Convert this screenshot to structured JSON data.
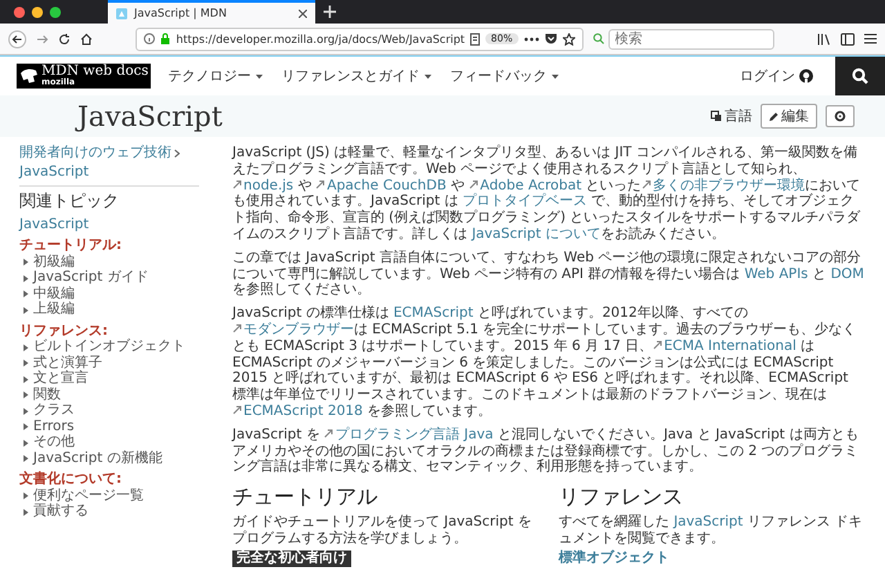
{
  "browser": {
    "tabs": [
      {
        "title": "JavaScript | MDN",
        "selected": true
      }
    ],
    "url": "https://developer.mozilla.org/ja/docs/Web/JavaScript",
    "zoom": "80%",
    "search": {
      "placeholder": "検索"
    }
  },
  "header": {
    "logo": {
      "title": "MDN web docs",
      "sub": "mozilla"
    },
    "menus": [
      {
        "label": "テクノロジー"
      },
      {
        "label": "リファレンスとガイド"
      },
      {
        "label": "フィードバック"
      }
    ],
    "login": "ログイン"
  },
  "title_band": {
    "title": "JavaScript",
    "language": "言語",
    "edit": "編集"
  },
  "sidebar": {
    "breadcrumbs": [
      "開発者向けのウェブ技術",
      "JavaScript"
    ],
    "heading": "関連トピック",
    "top_link": "JavaScript",
    "groups": [
      {
        "title": "チュートリアル:",
        "items": [
          {
            "label": "初級編",
            "expanded": false
          },
          {
            "label": "JavaScript ガイド",
            "expanded": false
          },
          {
            "label": "中級編",
            "expanded": false
          },
          {
            "label": "上級編",
            "expanded": false
          }
        ]
      },
      {
        "title": "リファレンス:",
        "items": [
          {
            "label": "ビルトインオブジェクト",
            "expanded": false
          },
          {
            "label": "式と演算子",
            "expanded": false
          },
          {
            "label": "文と宣言",
            "expanded": false
          },
          {
            "label": "関数",
            "expanded": false
          },
          {
            "label": "クラス",
            "expanded": false
          },
          {
            "label": "Errors",
            "expanded": false
          },
          {
            "label": "その他",
            "expanded": false
          },
          {
            "label": "JavaScript の新機能",
            "expanded": false
          }
        ]
      },
      {
        "title": "文書化について:",
        "items": [
          {
            "label": "便利なページ一覧",
            "expanded": false
          },
          {
            "label": "貢献する",
            "expanded": false
          }
        ]
      }
    ]
  },
  "article": {
    "paragraphs": [
      [
        {
          "kind": "text",
          "text": "JavaScript (JS) は軽量で、軽量なインタプリタ型、あるいは JIT コンパイルされる、第一級関数を備えたプログラミング言語です。Web ページでよく使用されるスクリプト言語として知られ、"
        },
        {
          "kind": "link",
          "text": "node.js",
          "external": true
        },
        {
          "kind": "text",
          "text": " や "
        },
        {
          "kind": "link",
          "text": "Apache CouchDB",
          "external": true
        },
        {
          "kind": "text",
          "text": " や "
        },
        {
          "kind": "link",
          "text": "Adobe Acrobat",
          "external": true
        },
        {
          "kind": "text",
          "text": " といった"
        },
        {
          "kind": "link",
          "text": "多くの非ブラウザー環境",
          "external": true
        },
        {
          "kind": "text",
          "text": "においても使用されています。JavaScript は "
        },
        {
          "kind": "link",
          "text": "プロトタイプベース",
          "external": false
        },
        {
          "kind": "text",
          "text": " で、動的型付けを持ち、そしてオブジェクト指向、命令形、宣言的 (例えば関数プログラミング) といったスタイルをサポートするマルチパラダイムのスクリプト言語です。詳しくは "
        },
        {
          "kind": "link",
          "text": "JavaScript について",
          "external": false
        },
        {
          "kind": "text",
          "text": "をお読みください。"
        }
      ],
      [
        {
          "kind": "text",
          "text": "この章では JavaScript 言語自体について、すなわち Web ページ他の環境に限定されないコアの部分について専門に解説しています。Web ページ特有の API 群の情報を得たい場合は "
        },
        {
          "kind": "link",
          "text": "Web APIs",
          "external": false
        },
        {
          "kind": "text",
          "text": " と "
        },
        {
          "kind": "link",
          "text": "DOM",
          "external": false
        },
        {
          "kind": "text",
          "text": " を参照してください。"
        }
      ],
      [
        {
          "kind": "text",
          "text": "JavaScript の標準仕様は "
        },
        {
          "kind": "link",
          "text": "ECMAScript",
          "external": false
        },
        {
          "kind": "text",
          "text": " と呼ばれています。2012年以降、すべての"
        },
        {
          "kind": "link",
          "text": "モダンブラウザー",
          "external": true
        },
        {
          "kind": "text",
          "text": "は ECMAScript 5.1 を完全にサポートしています。過去のブラウザーも、少なくとも ECMAScript 3 はサポートしています。2015 年 6 月 17 日、"
        },
        {
          "kind": "link",
          "text": "ECMA International",
          "external": true
        },
        {
          "kind": "text",
          "text": " は ECMAScript のメジャーバージョン 6 を策定しました。このバージョンは公式には ECMAScript 2015 と呼ばれていますが、最初は ECMAScript 6 や ES6 と呼ばれます。それ以降、ECMAScript 標準は年単位でリリースされています。このドキュメントは最新のドラフトバージョン、現在は "
        },
        {
          "kind": "link",
          "text": "ECMAScript 2018",
          "external": true
        },
        {
          "kind": "text",
          "text": " を参照しています。"
        }
      ],
      [
        {
          "kind": "text",
          "text": "JavaScript を "
        },
        {
          "kind": "link",
          "text": "プログラミング言語 Java",
          "external": true
        },
        {
          "kind": "text",
          "text": " と混同しないでください。Java と JavaScript は両方ともアメリカやその他の国においてオラクルの商標または登録商標です。しかし、この 2 つのプログラミング言語は非常に異なる構文、セマンティック、利用形態を持っています。"
        }
      ]
    ],
    "sections": [
      {
        "title": "チュートリアル",
        "intro": [
          {
            "kind": "text",
            "text": "ガイドやチュートリアルを使って JavaScript をプログラムする方法を学びましょう。"
          }
        ],
        "subheading": {
          "kind": "band",
          "text": "完全な初心者向け"
        }
      },
      {
        "title": "リファレンス",
        "intro": [
          {
            "kind": "text",
            "text": "すべてを網羅した "
          },
          {
            "kind": "link",
            "text": "JavaScript",
            "external": false
          },
          {
            "kind": "text",
            "text": " リファレンス ドキュメントを閲覧できます。"
          }
        ],
        "subheading": {
          "kind": "link",
          "text": "標準オブジェクト"
        }
      }
    ]
  }
}
